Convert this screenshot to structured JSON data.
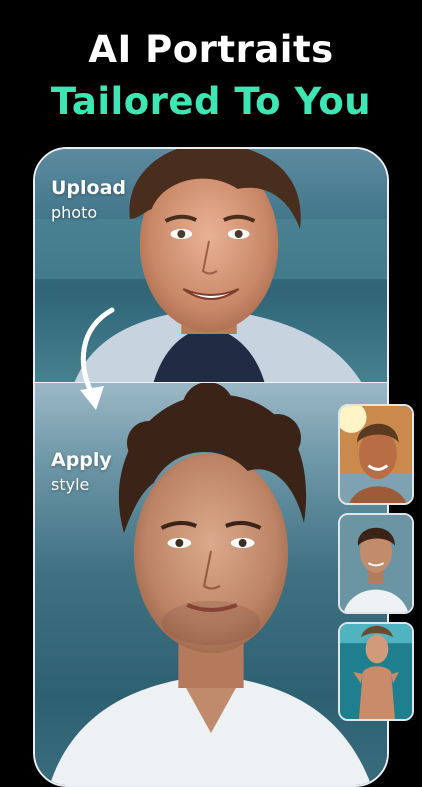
{
  "headline": {
    "line1": "AI Portraits",
    "line2": "Tailored To You"
  },
  "steps": {
    "upload": {
      "title": "Upload",
      "subtitle": "photo"
    },
    "apply": {
      "title": "Apply",
      "subtitle": "style"
    }
  },
  "colors": {
    "background": "#000000",
    "accent": "#3ee6b4",
    "frame_border": "#e9eef2"
  },
  "icons": {
    "arrow": "curved-arrow-down-icon"
  },
  "style_thumbnails": [
    {
      "name": "sunlit-beach-style"
    },
    {
      "name": "white-shirt-style"
    },
    {
      "name": "underwater-style"
    }
  ]
}
